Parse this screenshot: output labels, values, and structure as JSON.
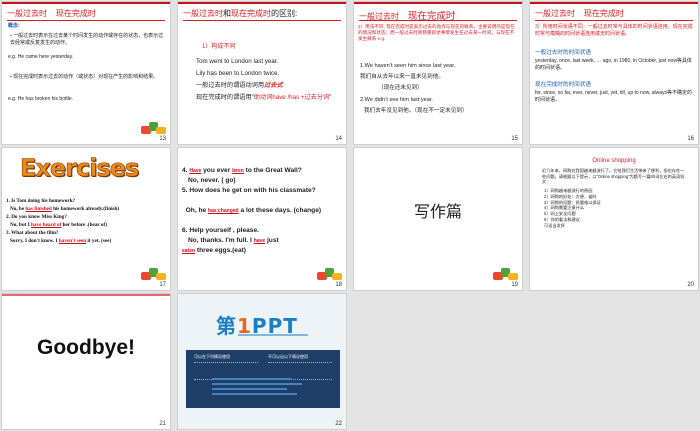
{
  "slides": [
    {
      "num": "13",
      "title_a": "一般过去时",
      "title_b": "现在完成时",
      "concept": "概念:",
      "b1": "一般过去时表示在过去某个时间发生的动作或存在的状态，也表示过去经常或反复发生的动作。",
      "ex1": "e.g.   He came here yesterday.",
      "b2": "现在完成时表示过去的动作（或状态）对现在产生的影响和结果。",
      "ex2": "e.g.   He has broken his bottle."
    },
    {
      "num": "14",
      "title_a": "一般过去时",
      "title_mid": "和",
      "title_b": "现在完成时",
      "title_c": "的区别:",
      "item": "1）构成不同",
      "l1": "Tom went to London last year.",
      "l2": "Lily has been to London twice.",
      "l3a": "一般过去时的谓语动词用",
      "l3b": "过去式",
      "l4a": "现在完成时的谓语用“",
      "l4b": "助动词have /has +过去分词",
      "l4c": "”"
    },
    {
      "num": "15",
      "title_a": "一般过去时",
      "title_b": "现在完成时",
      "p1": "2）用法不同: 现在完成时是表示过去的动作与现在的联系，主要说明的是现在的情况和状态；而一般过去时则侧重叙述事情发生在过去某一时间，与现在不发生联系 e.g.",
      "e1": "1.We haven’t seen him since last year.",
      "e1z": "我们自从去年以来一直未见到他。",
      "e1n": "（现在还未见到）",
      "e2": "2.We didn’t see him last year.",
      "e2z": "我们去年没见到他。（现在不一定未见到）"
    },
    {
      "num": "16",
      "title_a": "一般过去时",
      "title_b": "现在完成时",
      "p1": "3）所用时间状语不同：一般过去时常与具体的时间状语连用，现在完成时常与模糊的时间状语连用或无时间状语。",
      "h1": "一般过去时的时间状语",
      "l1": "yesterday, once, last week, … ago, in 1980, in October, just now等具体的时间状语。",
      "h2": "现在完成时的时间状语",
      "l2": "for, since, so far, ever, never, just, yet, till, up to now, always等不确定的时间状语。"
    },
    {
      "num": "17",
      "heading": "Exercises",
      "q1": "1. Is Tom doing his homework?",
      "a1a": "No, he",
      "a1b": "has finished",
      "a1c": "his homework already.(finish)",
      "q2": "2. Do you know Miss King?",
      "a2a": "No, but I",
      "a2b": "have heard of",
      "a2c": "her before .(hear of)",
      "q3": "3. What about the film?",
      "a3a": "Sorry, I don't know. I",
      "a3b": "haven't seen",
      "a3c": "it yet. (see)"
    },
    {
      "num": "18",
      "l1a": "4.",
      "l1b": "Have",
      "l1c": "you ever",
      "l1d": "been",
      "l1e": "to the Great Wall?",
      "l2": "No, never. ( go)",
      "l3": "5.  How does he get on with his classmate?",
      "l4a": "Oh, he",
      "l4b": "has changed",
      "l4c": "a lot these days. (change)",
      "l5": "6. Help yourself , please.",
      "l6a": "No, thanks.  I'm full.  I",
      "l6b": "have",
      "l6c": "just",
      "l7a": "eaten",
      "l7b": "three eggs.(eat)"
    },
    {
      "num": "19",
      "heading": "写作篇"
    },
    {
      "num": "20",
      "heading": "Online shopping",
      "intro": "近几年来，网购在我国越来越流行了。它给我们生活带来了便利，但也存在一些问题。请根据以下提示，以“Online shopping”为题写一篇80词左右的英语短文：",
      "items": [
        "1）网购越来越流行的原因",
        "2）网购的好处：方便、省时",
        "3）网购的问题：质量难以保证",
        "4）网购需要注意什么",
        "5）网上安全问题",
        "6）你的看法和建议"
      ],
      "note": "可适当发挥"
    },
    {
      "num": "21",
      "heading": "Goodbye!"
    },
    {
      "num": "22",
      "logo_a": "第",
      "logo_b": "1",
      "logo_c": "PPT",
      "col1": "可以在下列情况使用",
      "col2": "不可以出以下情况使用"
    }
  ]
}
